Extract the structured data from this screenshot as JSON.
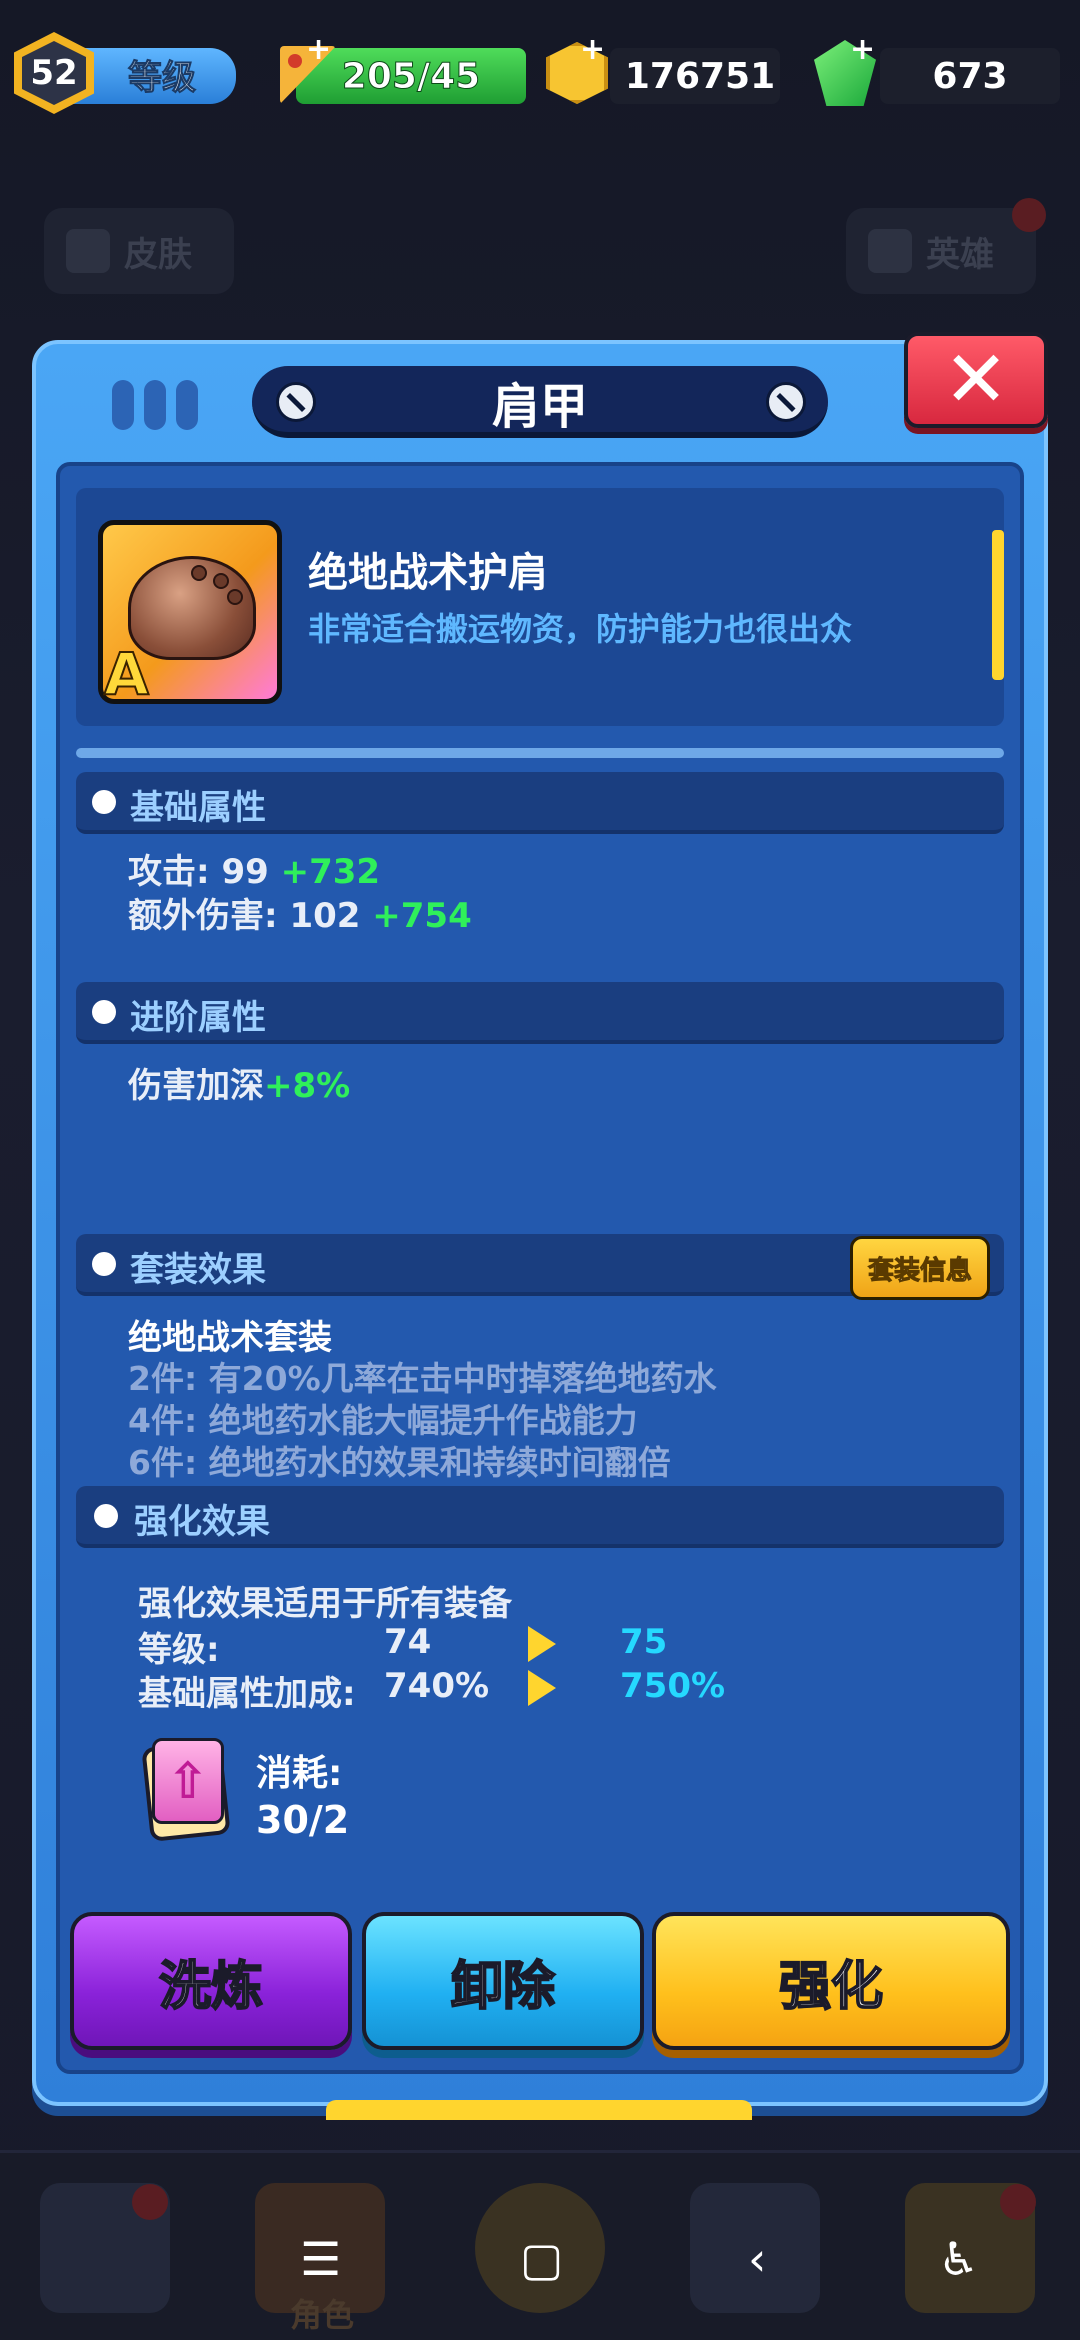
{
  "topbar": {
    "level": "52",
    "level_label": "等级",
    "stamina": "205/45",
    "coins": "176751",
    "gems": "673"
  },
  "background": {
    "skin_label": "皮肤",
    "hero_label": "英雄",
    "nav_active_label": "角色"
  },
  "modal": {
    "title": "肩甲",
    "item": {
      "name": "绝地战术护肩",
      "description": "非常适合搬运物资，防护能力也很出众",
      "grade": "A"
    },
    "base_attributes": {
      "title": "基础属性",
      "stats": [
        {
          "label": "攻击: ",
          "value": "99",
          "bonus": "+732"
        },
        {
          "label": "额外伤害: ",
          "value": "102",
          "bonus": "+754"
        }
      ]
    },
    "advanced_attributes": {
      "title": "进阶属性",
      "stats": [
        {
          "label": "伤害加深",
          "bonus": "+8%"
        }
      ]
    },
    "set_effect": {
      "title": "套装效果",
      "info_button": "套装信息",
      "set_name": "绝地战术套装",
      "lines": [
        "2件: 有20%几率在击中时掉落绝地药水",
        "4件: 绝地药水能大幅提升作战能力",
        "6件: 绝地药水的效果和持续时间翻倍"
      ]
    },
    "enhance": {
      "title": "强化效果",
      "note": "强化效果适用于所有装备",
      "level_label": "等级:",
      "level_current": "74",
      "level_next": "75",
      "bonus_label": "基础属性加成:",
      "bonus_current": "740%",
      "bonus_next": "750%",
      "cost_label": "消耗:",
      "cost_value": "30/2"
    },
    "buttons": {
      "refine": "洗炼",
      "unequip": "卸除",
      "enhance": "强化"
    }
  }
}
